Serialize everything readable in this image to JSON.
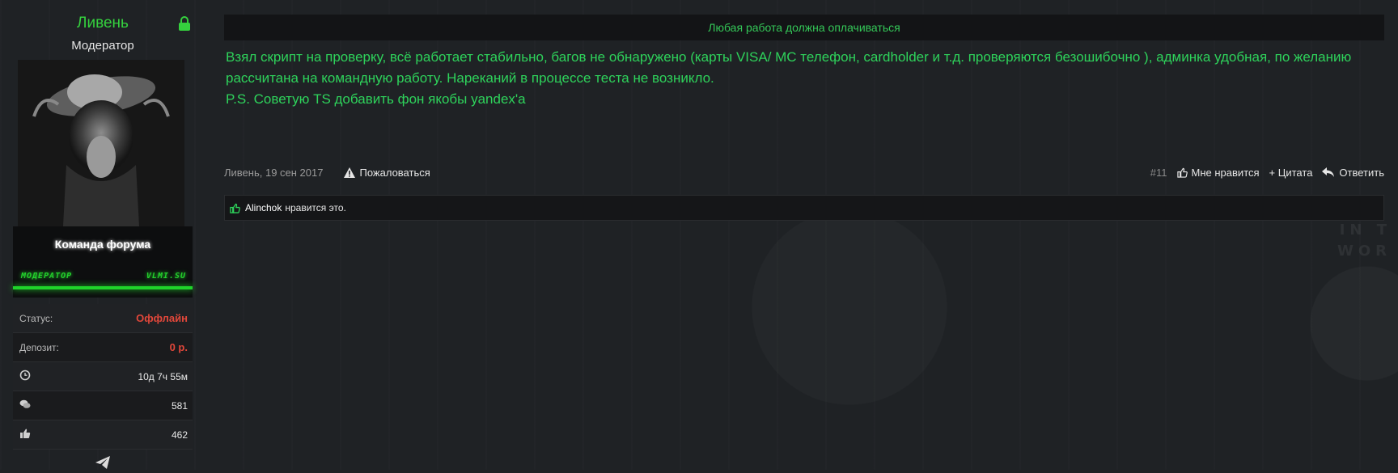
{
  "user": {
    "name": "Ливень",
    "title": "Модератор",
    "team_label": "Команда форума",
    "tag_left": "МОДЕРАТОР",
    "tag_right": "VLMI.SU",
    "stats": [
      {
        "label": "Статус:",
        "value": "Оффлайн",
        "icon": ""
      },
      {
        "label": "Депозит:",
        "value": "0 р.",
        "icon": ""
      },
      {
        "label": "",
        "value": "10д 7ч 55м",
        "icon": "clock-icon"
      },
      {
        "label": "",
        "value": "581",
        "icon": "chat-bubbles-icon"
      },
      {
        "label": "",
        "value": "462",
        "icon": "thumbs-up-icon"
      }
    ]
  },
  "post": {
    "title": "Любая работа должна оплачиваться",
    "lines": [
      "Взял скрипт на проверку, всё работает стабильно, багов не обнаружено (карты VISA/ MC телефон, cardholder и т.д. проверяются безошибочно ), админка удобная, по желанию рассчитана на командную работу. Нареканий в процессе теста не возникло.",
      "P.S. Советую TS добавить фон якобы yandex'a"
    ],
    "date": "Ливень, 19 сен 2017",
    "report_label": "Пожаловаться",
    "number": "#11",
    "like_label": "Мне нравится",
    "quote_label": "+ Цитата",
    "reply_label": "Ответить",
    "liked_by": "Alinchok",
    "liked_suffix": "нравится это."
  },
  "background_deco": "IN T\nWOR",
  "colors": {
    "accent_green": "#2ed35b",
    "username_green": "#35d13e",
    "status_red": "#e2473a",
    "bg": "#1f2225"
  }
}
